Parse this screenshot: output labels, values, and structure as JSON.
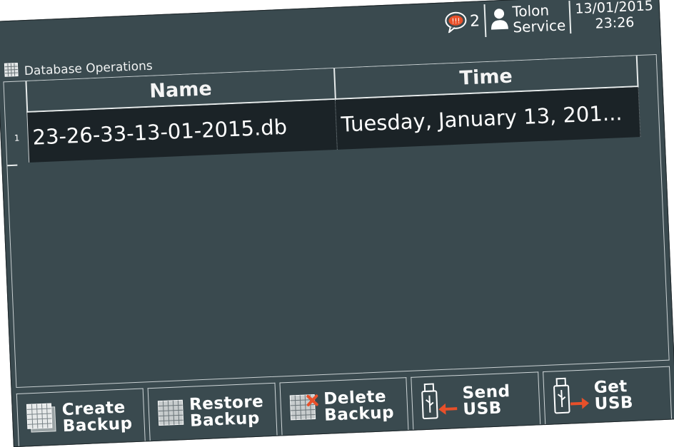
{
  "status": {
    "alarm_count": "2",
    "user_line1": "Tolon",
    "user_line2": "Service",
    "date": "13/01/2015",
    "time": "23:26"
  },
  "window": {
    "title": "Database Operations"
  },
  "table": {
    "columns": [
      "Name",
      "Time"
    ],
    "rows": [
      {
        "index": "1",
        "name": "23-26-33-13-01-2015.db",
        "time": "Tuesday, January 13, 201..."
      }
    ]
  },
  "buttons": {
    "create": [
      "Create",
      "Backup"
    ],
    "restore": [
      "Restore",
      "Backup"
    ],
    "delete": [
      "Delete",
      "Backup"
    ],
    "send": [
      "Send",
      "USB"
    ],
    "get": [
      "Get",
      "USB"
    ]
  },
  "colors": {
    "background": "#3a4a4f",
    "row_fill": "#1b2327",
    "accent_arrow": "#e8502a",
    "delete_x": "#e8502a"
  }
}
